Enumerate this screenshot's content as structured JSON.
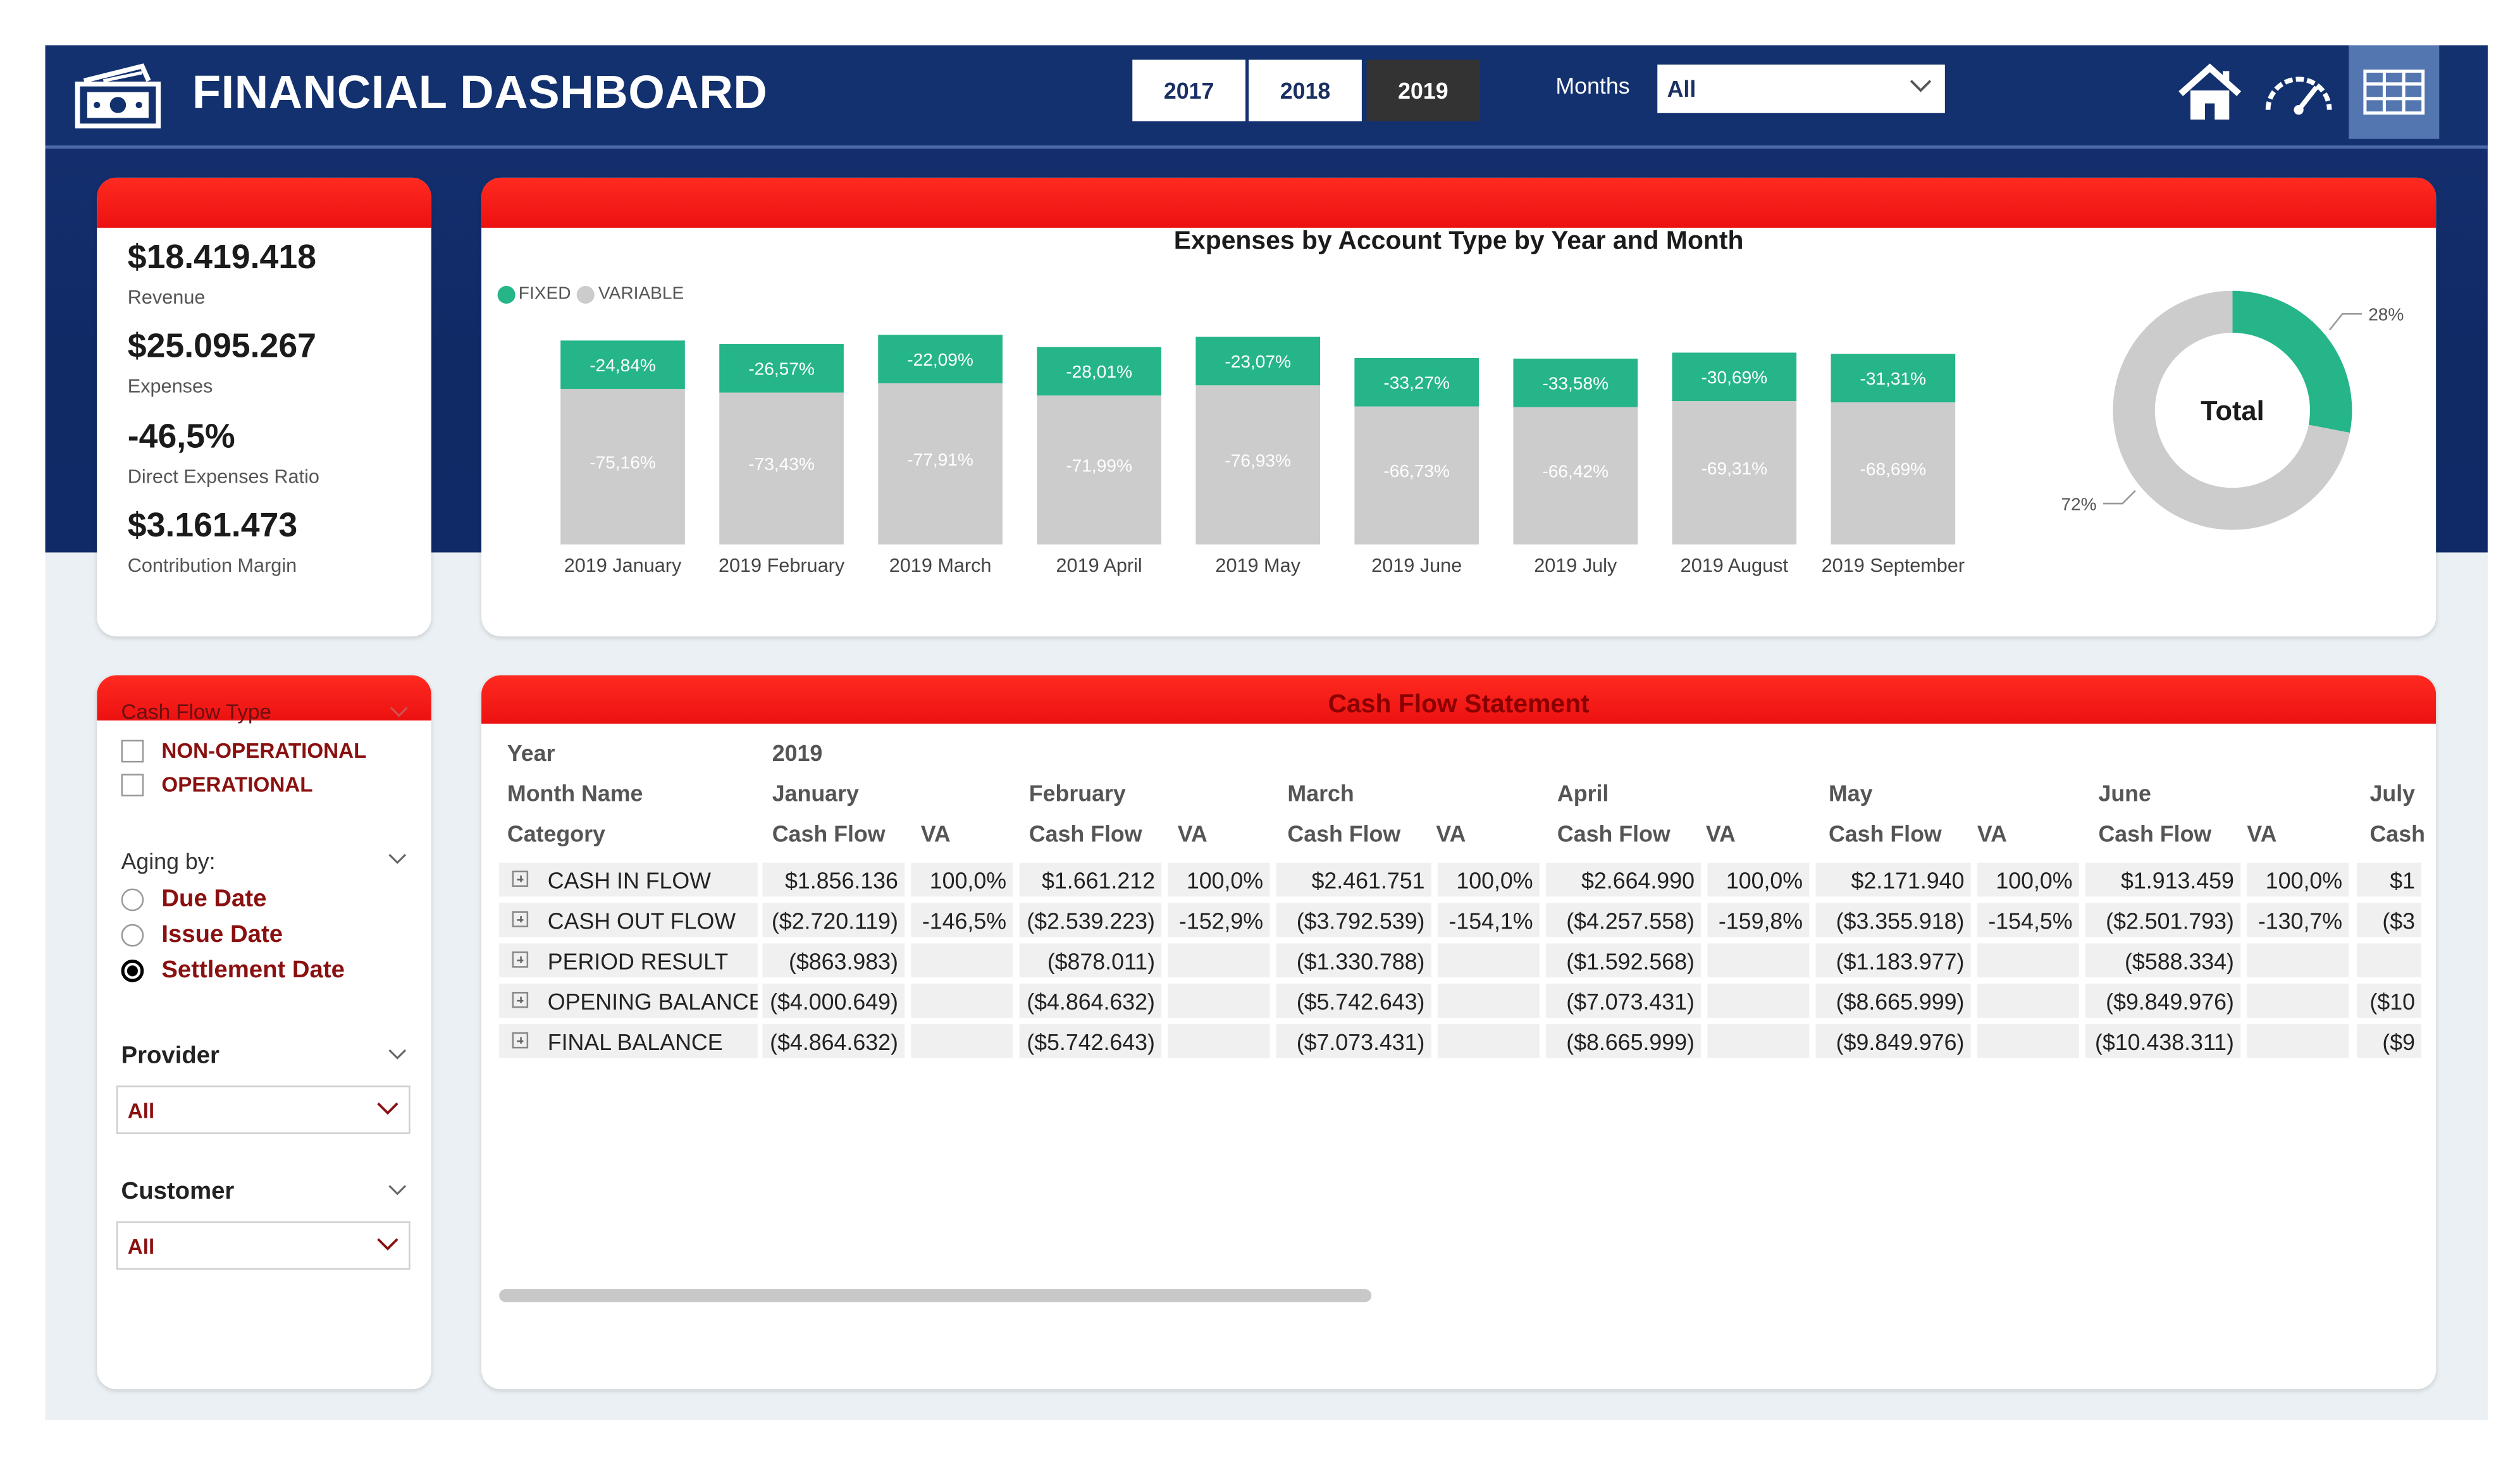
{
  "header": {
    "title": "FINANCIAL DASHBOARD",
    "years": [
      "2017",
      "2018",
      "2019"
    ],
    "selected_year": "2019",
    "months_label": "Months",
    "months_value": "All",
    "nav_icons": [
      "home-icon",
      "gauge-icon",
      "table-icon"
    ]
  },
  "kpis": [
    {
      "value": "$18.419.418",
      "label": "Revenue"
    },
    {
      "value": "$25.095.267",
      "label": "Expenses"
    },
    {
      "value": "-46,5%",
      "label": "Direct Expenses Ratio"
    },
    {
      "value": "$3.161.473",
      "label": "Contribution Margin"
    }
  ],
  "expenses_chart": {
    "title": "Expenses by Account Type by Year and Month",
    "legend": [
      "FIXED",
      "VARIABLE"
    ]
  },
  "chart_data": [
    {
      "type": "bar",
      "stacked": true,
      "title": "Expenses by Account Type by Year and Month",
      "categories": [
        "2019 January",
        "2019 February",
        "2019 March",
        "2019 April",
        "2019 May",
        "2019 June",
        "2019 July",
        "2019 August",
        "2019 September"
      ],
      "series": [
        {
          "name": "FIXED",
          "color": "#25b589",
          "values": [
            -24.84,
            -26.57,
            -22.09,
            -28.01,
            -23.07,
            -33.27,
            -33.58,
            -30.69,
            -31.31
          ],
          "labels": [
            "-24,84%",
            "-26,57%",
            "-22,09%",
            "-28,01%",
            "-23,07%",
            "-33,27%",
            "-33,58%",
            "-30,69%",
            "-31,31%"
          ]
        },
        {
          "name": "VARIABLE",
          "color": "#cccccc",
          "values": [
            -75.16,
            -73.43,
            -77.91,
            -71.99,
            -76.93,
            -66.73,
            -66.42,
            -69.31,
            -68.69
          ],
          "labels": [
            "-75,16%",
            "-73,43%",
            "-77,91%",
            "-71,99%",
            "-76,93%",
            "-66,73%",
            "-66,42%",
            "-69,31%",
            "-68,69%"
          ]
        }
      ],
      "legend_position": "top-left"
    },
    {
      "type": "pie",
      "donut": true,
      "center_label": "Total",
      "slices": [
        {
          "name": "FIXED",
          "value": 28,
          "label": "28%",
          "color": "#25b589"
        },
        {
          "name": "VARIABLE",
          "value": 72,
          "label": "72%",
          "color": "#cccccc"
        }
      ]
    }
  ],
  "filters": {
    "cash_flow_type": {
      "title": "Cash Flow Type",
      "options": [
        "NON-OPERATIONAL",
        "OPERATIONAL"
      ]
    },
    "aging": {
      "title": "Aging by:",
      "options": [
        "Due Date",
        "Issue Date",
        "Settlement Date"
      ],
      "selected": "Settlement Date"
    },
    "provider": {
      "title": "Provider",
      "value": "All"
    },
    "customer": {
      "title": "Customer",
      "value": "All"
    }
  },
  "cash_flow": {
    "title": "Cash Flow Statement",
    "year_label": "Year",
    "year_value": "2019",
    "month_label": "Month Name",
    "category_label": "Category",
    "months": [
      "January",
      "February",
      "March",
      "April",
      "May",
      "June",
      "July"
    ],
    "sub_headers": [
      "Cash Flow",
      "VA"
    ],
    "last_subheader": "Cash",
    "rows": [
      {
        "category": "CASH IN FLOW",
        "cells": [
          "$1.856.136",
          "100,0%",
          "$1.661.212",
          "100,0%",
          "$2.461.751",
          "100,0%",
          "$2.664.990",
          "100,0%",
          "$2.171.940",
          "100,0%",
          "$1.913.459",
          "100,0%",
          "$1"
        ]
      },
      {
        "category": "CASH OUT FLOW",
        "cells": [
          "($2.720.119)",
          "-146,5%",
          "($2.539.223)",
          "-152,9%",
          "($3.792.539)",
          "-154,1%",
          "($4.257.558)",
          "-159,8%",
          "($3.355.918)",
          "-154,5%",
          "($2.501.793)",
          "-130,7%",
          "($3"
        ]
      },
      {
        "category": "PERIOD RESULT",
        "cells": [
          "($863.983)",
          "",
          "($878.011)",
          "",
          "($1.330.788)",
          "",
          "($1.592.568)",
          "",
          "($1.183.977)",
          "",
          "($588.334)",
          "",
          ""
        ]
      },
      {
        "category": "OPENING BALANCE",
        "cells": [
          "($4.000.649)",
          "",
          "($4.864.632)",
          "",
          "($5.742.643)",
          "",
          "($7.073.431)",
          "",
          "($8.665.999)",
          "",
          "($9.849.976)",
          "",
          "($10"
        ]
      },
      {
        "category": "FINAL BALANCE",
        "cells": [
          "($4.864.632)",
          "",
          "($5.742.643)",
          "",
          "($7.073.431)",
          "",
          "($8.665.999)",
          "",
          "($9.849.976)",
          "",
          "($10.438.311)",
          "",
          "($9"
        ]
      }
    ]
  }
}
